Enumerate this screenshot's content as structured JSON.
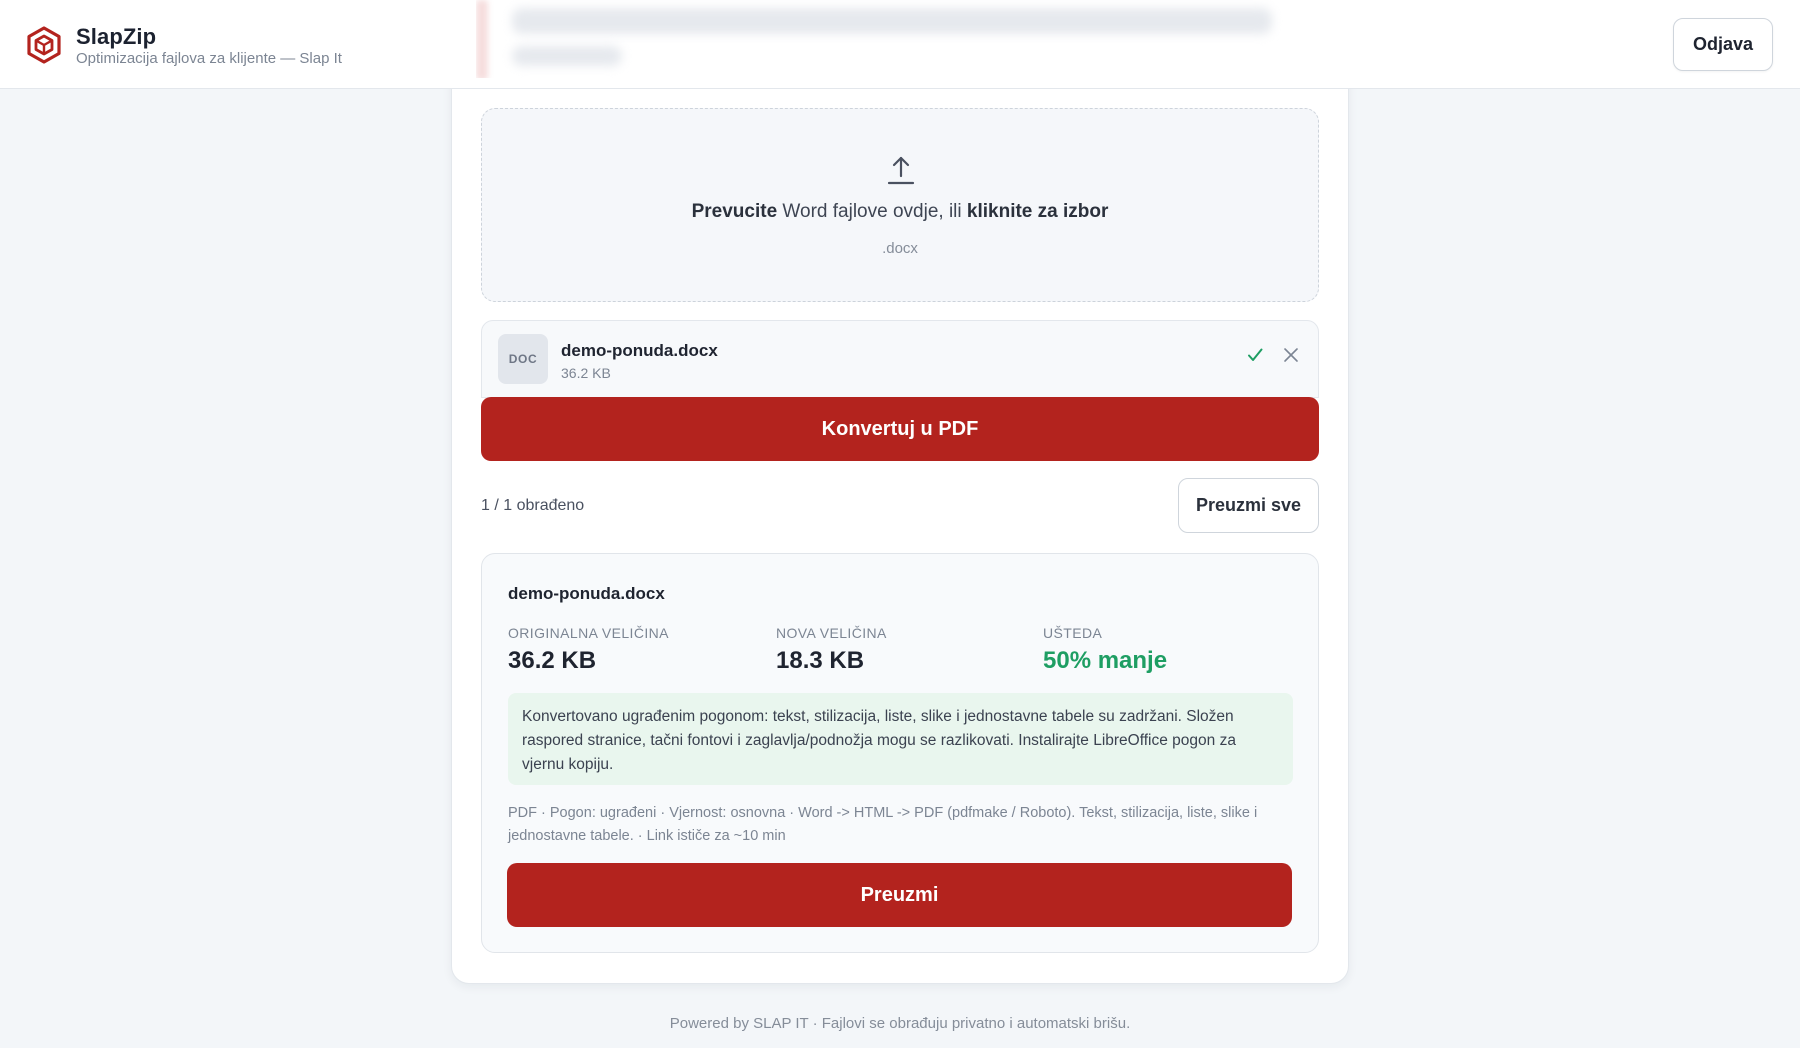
{
  "header": {
    "brand_name": "SlapZip",
    "tagline": "Optimizacija fajlova za klijente — Slap It",
    "logout_label": "Odjava",
    "logo_icon": "hexagon-cube-logo-icon",
    "brand_color": "#b3231e"
  },
  "dropzone": {
    "upload_icon": "upload-arrow-icon",
    "text_bold_1": "Prevucite",
    "text_mid": " Word fajlove ovdje, ili ",
    "text_bold_2": "kliknite za izbor",
    "accepted_ext": ".docx"
  },
  "file": {
    "badge": "DOC",
    "name": "demo-ponuda.docx",
    "size": "36.2 KB",
    "status_icon": "checkmark-icon",
    "remove_icon": "close-icon"
  },
  "actions": {
    "convert_label": "Konvertuj u PDF",
    "processed_count": "1 / 1 obrađeno",
    "download_all_label": "Preuzmi sve"
  },
  "result": {
    "file_name": "demo-ponuda.docx",
    "original_label": "ORIGINALNA VELIČINA",
    "original_value": "36.2 KB",
    "new_label": "NOVA VELIČINA",
    "new_value": "18.3 KB",
    "savings_label": "UŠTEDA",
    "savings_value": "50% manje",
    "savings_color": "#1e9e63",
    "info_text": "Konvertovano ugrađenim pogonom: tekst, stilizacija, liste, slike i jednostavne tabele su zadržani. Složen raspored stranice, tačni fontovi i zaglavlja/podnožja mogu se razlikovati. Instalirajte LibreOffice pogon za vjernu kopiju.",
    "meta_text": "PDF · Pogon: ugrađeni · Vjernost: osnovna · Word -> HTML -> PDF (pdfmake / Roboto). Tekst, stilizacija, liste, slike i jednostavne tabele. · Link ističe za ~10 min",
    "download_label": "Preuzmi"
  },
  "footer": {
    "text": "Powered by SLAP IT · Fajlovi se obrađuju privatno i automatski brišu."
  }
}
